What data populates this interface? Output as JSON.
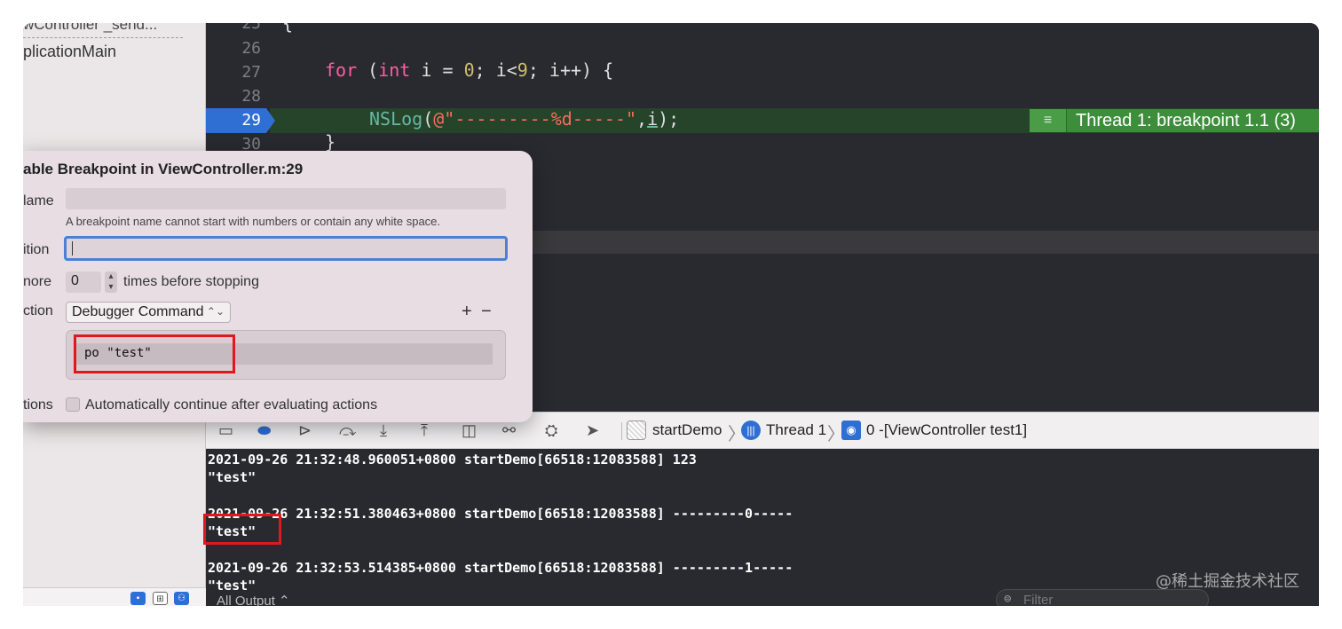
{
  "navigator": {
    "row_1": "wController _send...",
    "row_2": "plicationMain"
  },
  "editor": {
    "lines": [
      {
        "num": "25",
        "code": "{"
      },
      {
        "num": "26",
        "code": ""
      },
      {
        "num": "27",
        "code": "for (int i = 0; i<9; i++) {"
      },
      {
        "num": "28",
        "code": ""
      },
      {
        "num": "29",
        "code": "NSLog(@\"---------%d-----\",i);"
      },
      {
        "num": "30",
        "code": "}"
      }
    ],
    "code_27": {
      "kw_for": "for",
      "open": " (",
      "kw_int": "int",
      "mid1": " i = ",
      "zero": "0",
      "mid2": "; i<",
      "nine": "9",
      "rest": "; i++) {"
    },
    "code_29": {
      "fn": "NSLog",
      "open": "(",
      "str": "@\"---------%d-----\"",
      "comma": ",",
      "var": "i",
      "close": ");"
    },
    "code_30": "}",
    "code_25": "{",
    "breakpoint_line": "29",
    "thread_badge": "Thread 1: breakpoint 1.1 (3)"
  },
  "popover": {
    "title": "able Breakpoint in ViewController.m:29",
    "name_label": "lame",
    "name_hint": "A breakpoint name cannot start with numbers or contain any white space.",
    "condition_label": "ition",
    "ignore_label": "nore",
    "ignore_value": "0",
    "ignore_suffix": "times before stopping",
    "action_label": "ction",
    "action_value": "Debugger Command",
    "add_label": "+",
    "remove_label": "−",
    "command_value": "po \"test\"",
    "options_label": "tions",
    "auto_continue_label": "Automatically continue after evaluating actions"
  },
  "debug_bar": {
    "crumb_app": "startDemo",
    "crumb_thread": "Thread 1",
    "crumb_frame": "0 -[ViewController test1]"
  },
  "console": {
    "lines": [
      "2021-09-26 21:32:48.960051+0800 startDemo[66518:12083588] 123",
      "\"test\"",
      "2021-09-26 21:32:51.380463+0800 startDemo[66518:12083588] ---------0-----",
      "\"test\"",
      "2021-09-26 21:32:53.514385+0800 startDemo[66518:12083588] ---------1-----",
      "\"test\""
    ],
    "output_select": "All Output ⌃",
    "filter_placeholder": "Filter"
  },
  "watermark": "@稀土掘金技术社区",
  "colors": {
    "editor_bg": "#292a30",
    "keyword": "#fc5fa3",
    "number": "#d0bf69",
    "function": "#67b7a4",
    "string": "#fc6a5d",
    "breakpoint": "#2f6fd3",
    "thread_badge": "#3d8e3b",
    "highlight_box": "#e0181c"
  },
  "icons": {
    "debug_bar": [
      "hide-console-icon",
      "breakpoint-toggle-icon",
      "continue-icon",
      "step-over-icon",
      "step-into-icon",
      "step-out-icon",
      "view-hierarchy-icon",
      "memory-graph-icon",
      "environment-icon",
      "location-icon"
    ]
  }
}
